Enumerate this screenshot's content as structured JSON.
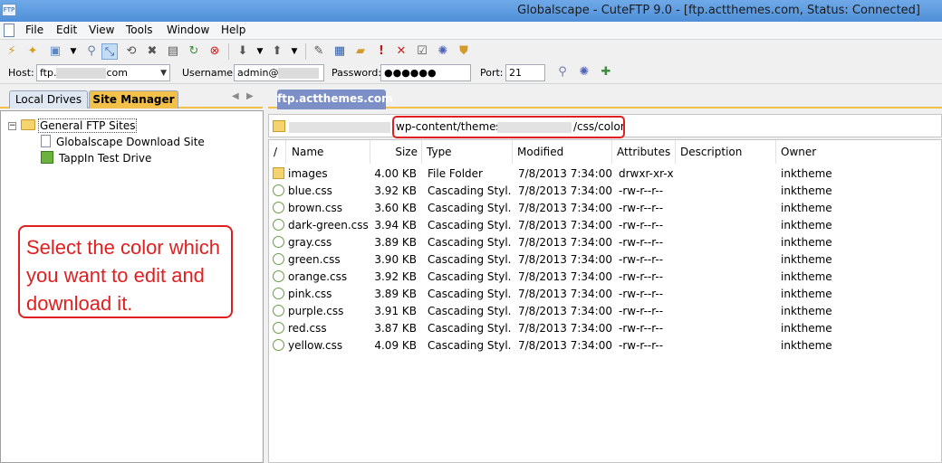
{
  "window": {
    "icon_text": "FTP",
    "title": "Globalscape - CuteFTP 9.0 - [ftp.actthemes.com, Status: Connected]"
  },
  "menu": [
    {
      "label": "File"
    },
    {
      "label": "Edit"
    },
    {
      "label": "View"
    },
    {
      "label": "Tools"
    },
    {
      "label": "Window"
    },
    {
      "label": "Help"
    }
  ],
  "toolbar": {
    "icons": [
      "connect-icon",
      "quick-connect-icon",
      "new-site-icon",
      "dropdown-icon",
      "disconnect-icon",
      "site-manager-icon",
      "reconnect-icon",
      "stop-icon",
      "filter-icon",
      "refresh-icon",
      "cancel-icon",
      "download-icon",
      "upload-icon",
      "edit-icon",
      "view-icon",
      "new-folder-icon",
      "exclamation-icon",
      "delete-icon",
      "properties-icon",
      "settings-icon",
      "shield-icon"
    ],
    "glyphs": {
      "stop": "✖",
      "exclamation": "!",
      "delete": "✕"
    }
  },
  "quickconnect": {
    "host_label": "Host:",
    "host_prefix": "ftp.",
    "host_suffix": "com",
    "username_label": "Username:",
    "username_value": "admin@",
    "password_label": "Password:",
    "password_value": "●●●●●●",
    "port_label": "Port:",
    "port_value": "21"
  },
  "left_tabs": {
    "local_drives": "Local Drives",
    "site_manager": "Site Manager"
  },
  "tree": {
    "root": "General FTP Sites",
    "children": [
      {
        "label": "Globalscape Download Site"
      },
      {
        "label": "TappIn Test Drive"
      }
    ]
  },
  "session_tab": {
    "label": "ftp.actthemes.com"
  },
  "path": {
    "part1": "wp-content/themes/",
    "part2": "/css/color"
  },
  "columns": {
    "sort": "/",
    "name": "Name",
    "size": "Size",
    "type": "Type",
    "modified": "Modified",
    "attributes": "Attributes",
    "description": "Description",
    "owner": "Owner"
  },
  "files": [
    {
      "name": "images",
      "size": "4.00 KB",
      "type": "File Folder",
      "modified": "7/8/2013 7:34:00 ...",
      "attributes": "drwxr-xr-x",
      "description": "",
      "owner": "inktheme",
      "kind": "folder"
    },
    {
      "name": "blue.css",
      "size": "3.92 KB",
      "type": "Cascading Styl...",
      "modified": "7/8/2013 7:34:00 ...",
      "attributes": "-rw-r--r--",
      "description": "",
      "owner": "inktheme",
      "kind": "css"
    },
    {
      "name": "brown.css",
      "size": "3.60 KB",
      "type": "Cascading Styl...",
      "modified": "7/8/2013 7:34:00 ...",
      "attributes": "-rw-r--r--",
      "description": "",
      "owner": "inktheme",
      "kind": "css"
    },
    {
      "name": "dark-green.css",
      "size": "3.94 KB",
      "type": "Cascading Styl...",
      "modified": "7/8/2013 7:34:00 ...",
      "attributes": "-rw-r--r--",
      "description": "",
      "owner": "inktheme",
      "kind": "css"
    },
    {
      "name": "gray.css",
      "size": "3.89 KB",
      "type": "Cascading Styl...",
      "modified": "7/8/2013 7:34:00 ...",
      "attributes": "-rw-r--r--",
      "description": "",
      "owner": "inktheme",
      "kind": "css"
    },
    {
      "name": "green.css",
      "size": "3.90 KB",
      "type": "Cascading Styl...",
      "modified": "7/8/2013 7:34:00 ...",
      "attributes": "-rw-r--r--",
      "description": "",
      "owner": "inktheme",
      "kind": "css"
    },
    {
      "name": "orange.css",
      "size": "3.92 KB",
      "type": "Cascading Styl...",
      "modified": "7/8/2013 7:34:00 ...",
      "attributes": "-rw-r--r--",
      "description": "",
      "owner": "inktheme",
      "kind": "css"
    },
    {
      "name": "pink.css",
      "size": "3.89 KB",
      "type": "Cascading Styl...",
      "modified": "7/8/2013 7:34:00 ...",
      "attributes": "-rw-r--r--",
      "description": "",
      "owner": "inktheme",
      "kind": "css"
    },
    {
      "name": "purple.css",
      "size": "3.91 KB",
      "type": "Cascading Styl...",
      "modified": "7/8/2013 7:34:00 ...",
      "attributes": "-rw-r--r--",
      "description": "",
      "owner": "inktheme",
      "kind": "css"
    },
    {
      "name": "red.css",
      "size": "3.87 KB",
      "type": "Cascading Styl...",
      "modified": "7/8/2013 7:34:00 ...",
      "attributes": "-rw-r--r--",
      "description": "",
      "owner": "inktheme",
      "kind": "css"
    },
    {
      "name": "yellow.css",
      "size": "4.09 KB",
      "type": "Cascading Styl...",
      "modified": "7/8/2013 7:34:00 ...",
      "attributes": "-rw-r--r--",
      "description": "",
      "owner": "inktheme",
      "kind": "css"
    }
  ],
  "callout": {
    "text": "Select the color which you want to edit and download it."
  },
  "colors": {
    "title_bar": "#5b9be0",
    "tab_highlight": "#f3c14a",
    "session_tab": "#7c8fc7",
    "annotation": "#e02020"
  }
}
